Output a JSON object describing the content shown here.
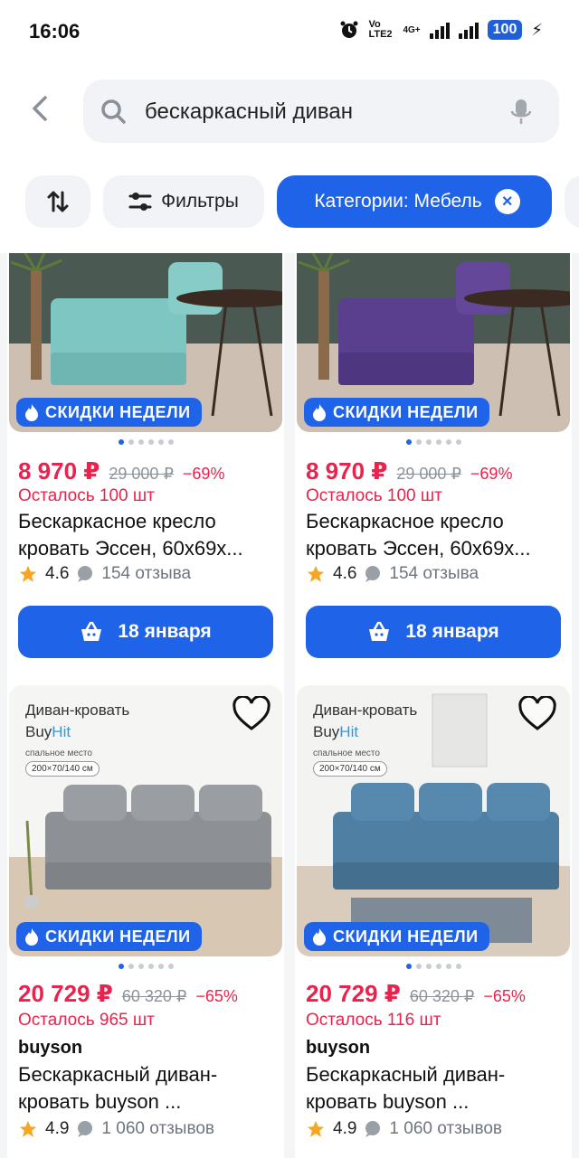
{
  "status_bar": {
    "time": "16:06",
    "network": "Vo LTE2",
    "network2": "4G+",
    "battery": "100",
    "icons": [
      "alarm-icon",
      "signal-icon",
      "signal-icon",
      "charging-icon"
    ]
  },
  "search": {
    "query": "бескаркасный диван",
    "icons": [
      "back-chevron-icon",
      "search-icon",
      "microphone-icon"
    ]
  },
  "chips": {
    "filters_label": "Фильтры",
    "category_label": "Категории: Мебель"
  },
  "products": [
    {
      "badge": "СКИДКИ НЕДЕЛИ",
      "price": "8 970 ₽",
      "old_price": "29 000 ₽",
      "discount": "−69%",
      "stock": "Осталось 100 шт",
      "title": "Бескаркасное кресло кровать Эссен, 60х69х...",
      "rating": "4.6",
      "reviews": "154 отзыва",
      "delivery": "18 января",
      "color": "#7dc6c2"
    },
    {
      "badge": "СКИДКИ НЕДЕЛИ",
      "price": "8 970 ₽",
      "old_price": "29 000 ₽",
      "discount": "−69%",
      "stock": "Осталось 100 шт",
      "title": "Бескаркасное кресло кровать Эссен, 60х69х...",
      "rating": "4.6",
      "reviews": "154 отзыва",
      "delivery": "18 января",
      "color": "#5a3f8f"
    },
    {
      "badge": "СКИДКИ НЕДЕЛИ",
      "image_head": "Диван-кровать",
      "image_brand_a": "Buy",
      "image_brand_b": "Hit",
      "image_sub": "спальное место",
      "image_size": "200×70/140 см",
      "price": "20 729 ₽",
      "old_price": "60 320 ₽",
      "discount": "−65%",
      "stock": "Осталось 965 шт",
      "brand": "buyson",
      "title": "Бескаркасный диван-кровать buyson ...",
      "rating": "4.9",
      "reviews": "1 060 отзывов",
      "color": "#8d9196"
    },
    {
      "badge": "СКИДКИ НЕДЕЛИ",
      "image_head": "Диван-кровать",
      "image_brand_a": "Buy",
      "image_brand_b": "Hit",
      "image_sub": "спальное место",
      "image_size": "200×70/140 см",
      "price": "20 729 ₽",
      "old_price": "60 320 ₽",
      "discount": "−65%",
      "stock": "Осталось 116 шт",
      "brand": "buyson",
      "title": "Бескаркасный диван-кровать buyson ...",
      "rating": "4.9",
      "reviews": "1 060 отзывов",
      "color": "#4f7fa3"
    }
  ],
  "colors": {
    "accent": "#1f63e9",
    "price_red": "#e8234d",
    "star": "#f5a623"
  }
}
